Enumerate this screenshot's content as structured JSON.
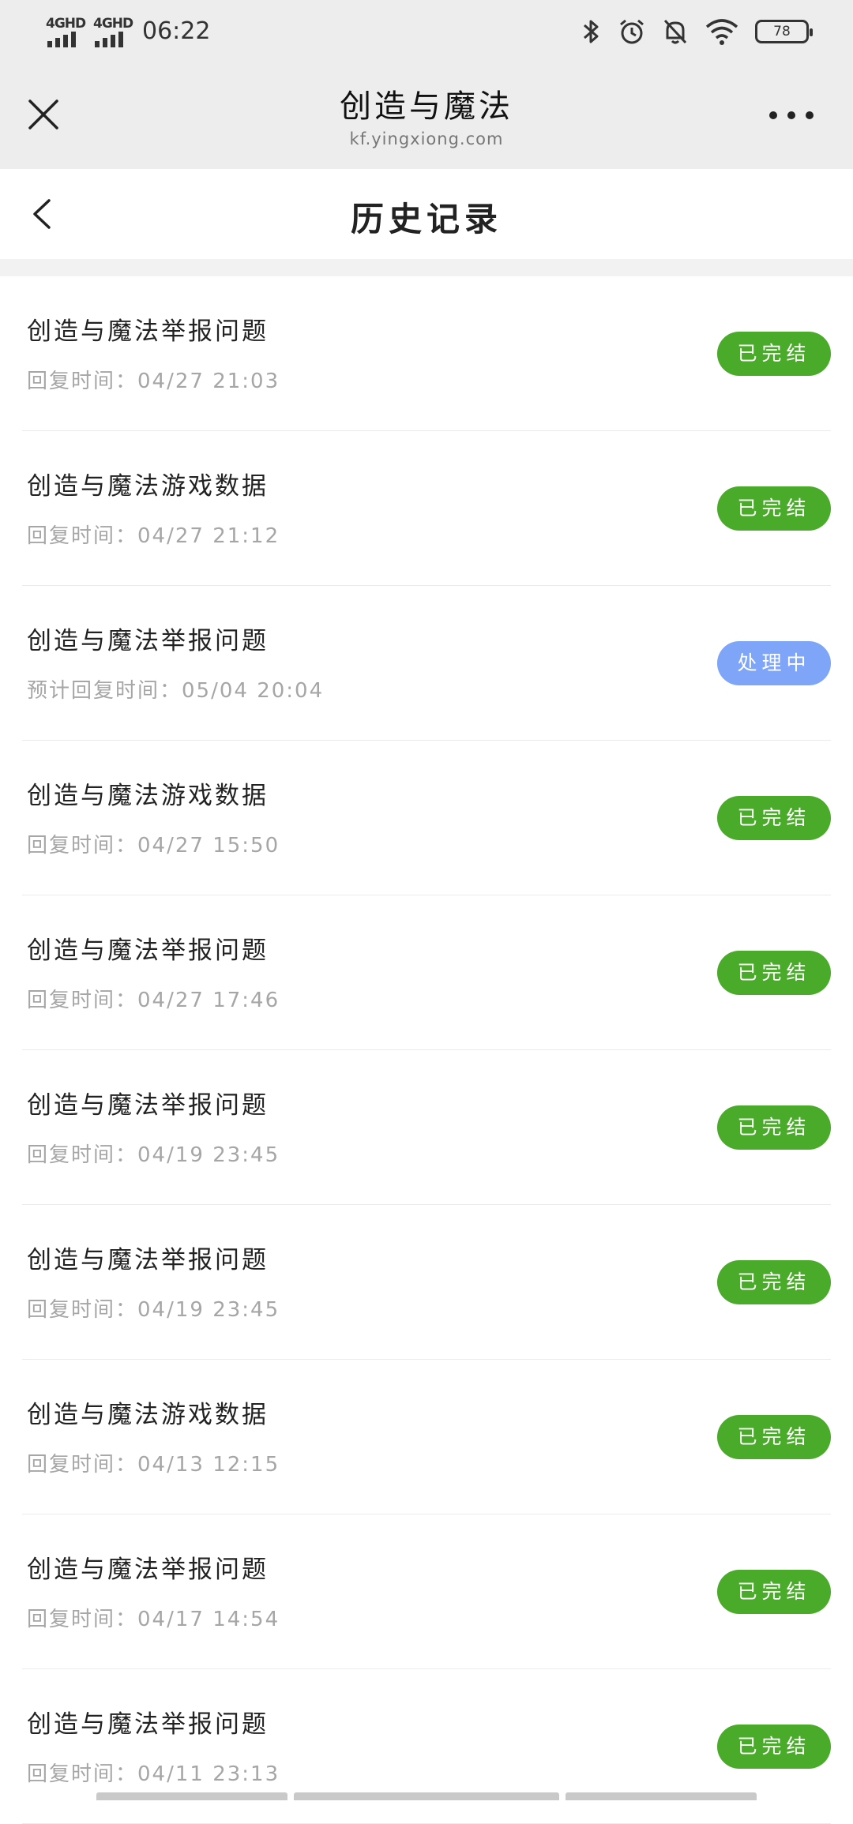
{
  "status_bar": {
    "network_1": "4GHD",
    "network_2": "4GHD",
    "time": "06:22",
    "battery": "78"
  },
  "webview": {
    "title": "创造与魔法",
    "url": "kf.yingxiong.com"
  },
  "page": {
    "title": "历史记录"
  },
  "colors": {
    "done": "#4aaa2a",
    "processing": "#7ea5f8"
  },
  "records": [
    {
      "title": "创造与魔法举报问题",
      "time": "回复时间：04/27 21:03",
      "status": "已完结",
      "state": "done"
    },
    {
      "title": "创造与魔法游戏数据",
      "time": "回复时间：04/27 21:12",
      "status": "已完结",
      "state": "done"
    },
    {
      "title": "创造与魔法举报问题",
      "time": "预计回复时间：05/04 20:04",
      "status": "处理中",
      "state": "processing"
    },
    {
      "title": "创造与魔法游戏数据",
      "time": "回复时间：04/27 15:50",
      "status": "已完结",
      "state": "done"
    },
    {
      "title": "创造与魔法举报问题",
      "time": "回复时间：04/27 17:46",
      "status": "已完结",
      "state": "done"
    },
    {
      "title": "创造与魔法举报问题",
      "time": "回复时间：04/19 23:45",
      "status": "已完结",
      "state": "done"
    },
    {
      "title": "创造与魔法举报问题",
      "time": "回复时间：04/19 23:45",
      "status": "已完结",
      "state": "done"
    },
    {
      "title": "创造与魔法游戏数据",
      "time": "回复时间：04/13 12:15",
      "status": "已完结",
      "state": "done"
    },
    {
      "title": "创造与魔法举报问题",
      "time": "回复时间：04/17 14:54",
      "status": "已完结",
      "state": "done"
    },
    {
      "title": "创造与魔法举报问题",
      "time": "回复时间：04/11 23:13",
      "status": "已完结",
      "state": "done"
    }
  ]
}
